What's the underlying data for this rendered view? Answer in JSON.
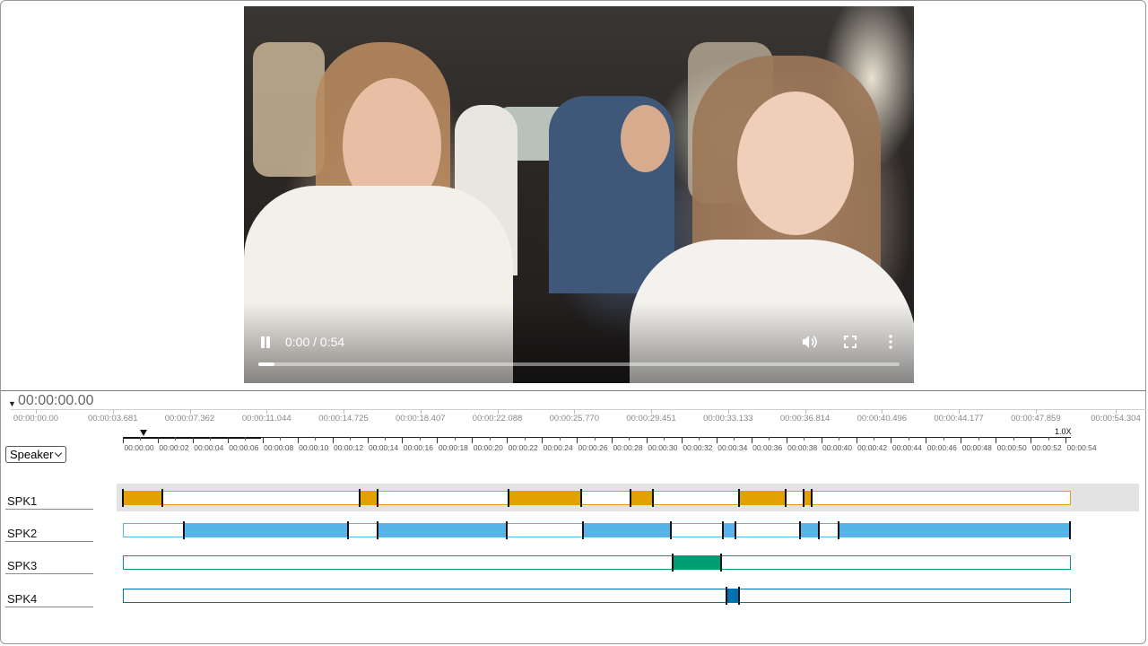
{
  "video": {
    "time_label": "0:00 / 0:54",
    "progress": 0.025,
    "controls": {
      "pause_icon": "pause-icon",
      "volume_icon": "volume-icon",
      "fullscreen_icon": "fullscreen-icon",
      "more_icon": "more-options-icon"
    }
  },
  "timeline": {
    "current_time": "00:00:00.00",
    "ruler_labels": [
      "00:00:00.00",
      "00:00:03.681",
      "00:00:07.362",
      "00:00:11.044",
      "00:00:14.725",
      "00:00:18.407",
      "00:00:22.088",
      "00:00:25.770",
      "00:00:29.451",
      "00:00:33.133",
      "00:00:36.814",
      "00:00:40.496",
      "00:00:44.177",
      "00:00:47.859",
      "00:00:54.304"
    ],
    "speed": "1.0X",
    "scale_labels": [
      "00:00:00",
      "00:00:02",
      "00:00:04",
      "00:00:06",
      "00:00:08",
      "00:00:10",
      "00:00:12",
      "00:00:14",
      "00:00:16",
      "00:00:18",
      "00:00:20",
      "00:00:22",
      "00:00:24",
      "00:00:26",
      "00:00:28",
      "00:00:30",
      "00:00:32",
      "00:00:34",
      "00:00:36",
      "00:00:38",
      "00:00:40",
      "00:00:42",
      "00:00:44",
      "00:00:46",
      "00:00:48",
      "00:00:50",
      "00:00:52",
      "00:00:54"
    ],
    "duration_seconds": 54.304,
    "group_by": {
      "label": "Speaker",
      "icon": "chevron-down-icon"
    }
  },
  "speakers": [
    {
      "name": "SPK1",
      "color": "#E69F00",
      "selected": true,
      "segments": [
        [
          0,
          2.3
        ],
        [
          13.6,
          14.6
        ],
        [
          22.1,
          26.3
        ],
        [
          29.1,
          30.4
        ],
        [
          35.3,
          38.0
        ],
        [
          39.0,
          39.5
        ]
      ],
      "boundaries": [
        0,
        2.3,
        13.6,
        14.6,
        22.1,
        26.3,
        29.1,
        30.4,
        35.3,
        38.0,
        39.0,
        39.5
      ]
    },
    {
      "name": "SPK2",
      "color": "#56B4E9",
      "selected": false,
      "segments": [
        [
          3.5,
          12.9
        ],
        [
          14.6,
          22.0
        ],
        [
          26.4,
          31.4
        ],
        [
          34.4,
          35.1
        ],
        [
          38.8,
          39.9
        ],
        [
          41.0,
          54.3
        ]
      ],
      "boundaries": [
        3.5,
        12.9,
        14.6,
        22.0,
        26.4,
        31.4,
        34.4,
        35.1,
        38.8,
        39.9,
        41.0,
        54.3
      ]
    },
    {
      "name": "SPK3",
      "color": "#009E73",
      "selected": false,
      "segments": [
        [
          31.5,
          34.3
        ]
      ],
      "boundaries": [
        31.5,
        34.3
      ]
    },
    {
      "name": "SPK4",
      "color": "#0072B2",
      "selected": false,
      "segments": [
        [
          34.6,
          35.3
        ]
      ],
      "boundaries": [
        34.6,
        35.3
      ]
    }
  ]
}
